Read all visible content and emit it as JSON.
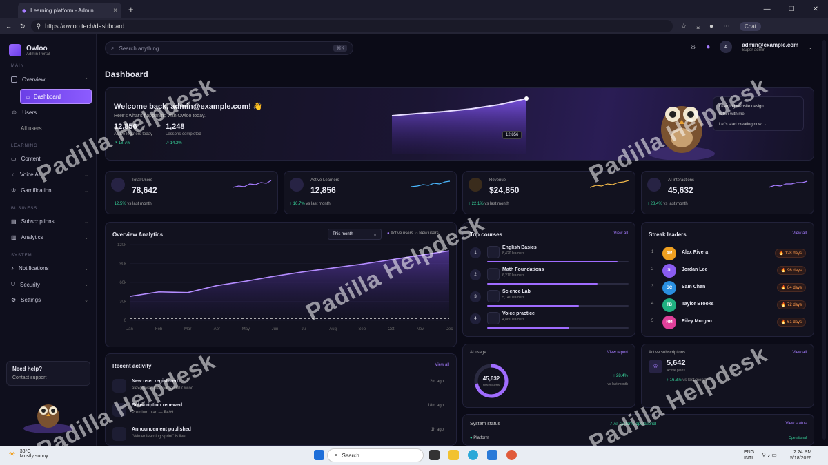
{
  "browser": {
    "tab_title": "Learning platform - Admin",
    "url": "https://owloo.tech/dashboard",
    "chat": "Chat"
  },
  "brand": {
    "name": "Owloo",
    "sub": "Admin Portal"
  },
  "sidebar": {
    "main_label": "MAIN",
    "learning_label": "LEARNING",
    "business_label": "BUSINESS",
    "system_label": "SYSTEM",
    "overview": "Overview",
    "dashboard": "Dashboard",
    "users": "Users",
    "all_users": "All users",
    "content": "Content",
    "voice_ai": "Voice AI",
    "gamification": "Gamification",
    "subscriptions": "Subscriptions",
    "analytics": "Analytics",
    "notifications": "Notifications",
    "security": "Security",
    "settings": "Settings",
    "help_title": "Need help?",
    "help_contact": "Contact support"
  },
  "search": {
    "placeholder": "Search anything...",
    "kbd": "⌘K"
  },
  "user": {
    "initial": "A",
    "email": "admin@example.com",
    "role": "Super admin"
  },
  "page_title": "Dashboard",
  "hero": {
    "welcome": "Welcome back, admin@example.com! 👋",
    "sub": "Here's what's happening with Owloo today.",
    "stat1_value": "12,856",
    "stat1_label": "Active learners today",
    "stat1_delta": "18.7%",
    "stat2_value": "1,248",
    "stat2_label": "Lessons completed",
    "stat2_delta": "14.2%",
    "tag": "12,856",
    "bubble_line1": "Learning website design",
    "bubble_line2": "is fun with me!",
    "bubble_line3": "Let's start creating now →"
  },
  "stats": [
    {
      "label": "Total Users",
      "value": "78,642",
      "delta": "↑ 12.5%",
      "note": "vs last month",
      "color": "#a67cff"
    },
    {
      "label": "Active Learners",
      "value": "12,856",
      "delta": "↑ 16.7%",
      "note": "vs last month",
      "color": "#4bb8ff"
    },
    {
      "label": "Revenue",
      "value": "$24,850",
      "delta": "↑ 22.1%",
      "note": "vs last month",
      "color": "#f0b84a"
    },
    {
      "label": "AI interactions",
      "value": "45,632",
      "delta": "↑ 28.4%",
      "note": "vs last month",
      "color": "#a67cff"
    }
  ],
  "analytics": {
    "title": "Overview Analytics",
    "range": "This month",
    "legend1": "Active users",
    "legend2": "New users",
    "yticks": [
      "120k",
      "90k",
      "60k",
      "30k",
      "0"
    ],
    "months": [
      "Jan",
      "Feb",
      "Mar",
      "Apr",
      "May",
      "Jun",
      "Jul",
      "Aug",
      "Sep",
      "Oct",
      "Nov",
      "Dec"
    ],
    "active": [
      38,
      45,
      44,
      55,
      62,
      70,
      77,
      83,
      89,
      96,
      103,
      110
    ],
    "new": [
      3,
      3,
      3,
      3,
      3,
      3,
      3,
      3,
      3,
      3,
      3,
      3
    ]
  },
  "courses": {
    "title": "Top courses",
    "view_all": "View all",
    "items": [
      {
        "num": "1",
        "name": "English Basics",
        "learners": "8,420 learners",
        "pct": 0.92
      },
      {
        "num": "2",
        "name": "Math Foundations",
        "learners": "6,210 learners",
        "pct": 0.78
      },
      {
        "num": "3",
        "name": "Science Lab",
        "learners": "5,140 learners",
        "pct": 0.65
      },
      {
        "num": "4",
        "name": "Voice practice",
        "learners": "4,860 learners",
        "pct": 0.58
      }
    ]
  },
  "streak": {
    "title": "Streak leaders",
    "view_all": "View all",
    "items": [
      {
        "rank": "1",
        "initials": "AR",
        "name": "Alex Rivera",
        "days": "128 days",
        "color": "#f0a020"
      },
      {
        "rank": "2",
        "initials": "JL",
        "name": "Jordan Lee",
        "days": "96 days",
        "color": "#8a5cf0"
      },
      {
        "rank": "3",
        "initials": "SC",
        "name": "Sam Chen",
        "days": "84 days",
        "color": "#2a8fe0"
      },
      {
        "rank": "4",
        "initials": "TB",
        "name": "Taylor Brooks",
        "days": "72 days",
        "color": "#20b080"
      },
      {
        "rank": "5",
        "initials": "RM",
        "name": "Riley Morgan",
        "days": "61 days",
        "color": "#e0409a"
      }
    ]
  },
  "activity": {
    "title": "Recent activity",
    "view_all": "View all",
    "items": [
      {
        "title": "New user registered",
        "sub": "alex@example.com joined Owloo",
        "time": "2m ago"
      },
      {
        "title": "Subscription renewed",
        "sub": "Premium plan — ₱499",
        "time": "18m ago"
      },
      {
        "title": "Announcement published",
        "sub": "\"Winter learning sprint\" is live",
        "time": "1h ago"
      }
    ]
  },
  "ai_usage": {
    "label": "AI usage",
    "link": "View report",
    "value": "45,632",
    "sub": "total requests",
    "delta": "↑ 28.4%",
    "note": "vs last month",
    "pct": 0.72
  },
  "subs": {
    "label": "Active subscriptions",
    "link": "View all",
    "value": "5,642",
    "sub": "Active plans",
    "delta": "↑ 16.3%",
    "note": "vs last month"
  },
  "system": {
    "title": "System status",
    "ok": "All systems operational",
    "link": "View status",
    "row": "Platform",
    "row_status": "Operational"
  },
  "watermark": "Padilla Helpdesk",
  "taskbar": {
    "temp": "33°C",
    "weather": "Mostly sunny",
    "search": "Search",
    "lang1": "ENG",
    "lang2": "INTL",
    "time": "2:24 PM",
    "date": "5/18/2026"
  }
}
